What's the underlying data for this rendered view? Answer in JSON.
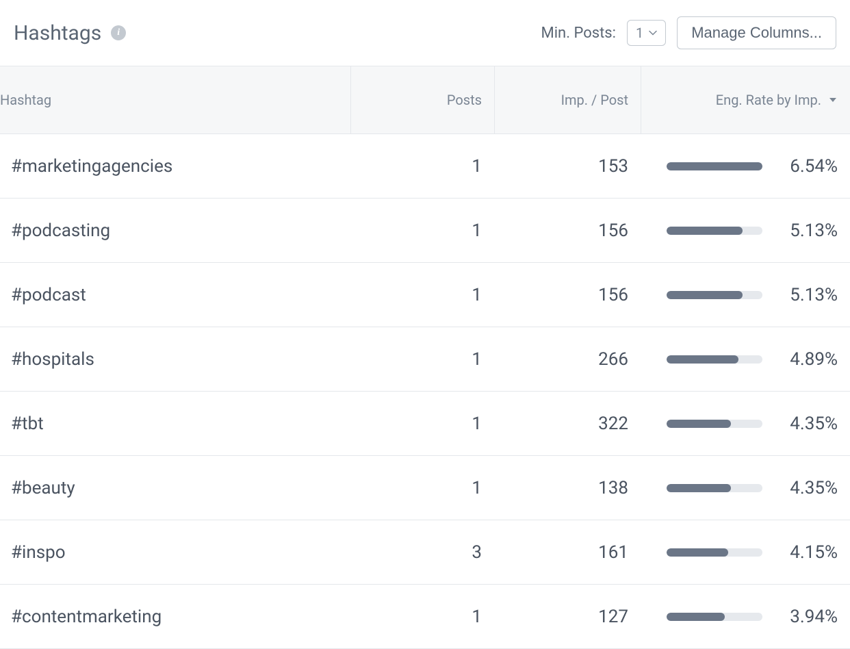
{
  "header": {
    "title": "Hashtags",
    "min_posts_label": "Min. Posts:",
    "min_posts_value": "1",
    "manage_columns_label": "Manage Columns..."
  },
  "columns": {
    "hashtag": "Hashtag",
    "posts": "Posts",
    "imp_per_post": "Imp. / Post",
    "eng_rate": "Eng. Rate by Imp."
  },
  "rows": [
    {
      "hashtag": "#marketingagencies",
      "posts": "1",
      "imp_per_post": "153",
      "eng_rate": "6.54%",
      "bar_pct": 100
    },
    {
      "hashtag": "#podcasting",
      "posts": "1",
      "imp_per_post": "156",
      "eng_rate": "5.13%",
      "bar_pct": 79
    },
    {
      "hashtag": "#podcast",
      "posts": "1",
      "imp_per_post": "156",
      "eng_rate": "5.13%",
      "bar_pct": 79
    },
    {
      "hashtag": "#hospitals",
      "posts": "1",
      "imp_per_post": "266",
      "eng_rate": "4.89%",
      "bar_pct": 75
    },
    {
      "hashtag": "#tbt",
      "posts": "1",
      "imp_per_post": "322",
      "eng_rate": "4.35%",
      "bar_pct": 67
    },
    {
      "hashtag": "#beauty",
      "posts": "1",
      "imp_per_post": "138",
      "eng_rate": "4.35%",
      "bar_pct": 67
    },
    {
      "hashtag": "#inspo",
      "posts": "3",
      "imp_per_post": "161",
      "eng_rate": "4.15%",
      "bar_pct": 64
    },
    {
      "hashtag": "#contentmarketing",
      "posts": "1",
      "imp_per_post": "127",
      "eng_rate": "3.94%",
      "bar_pct": 61
    }
  ]
}
